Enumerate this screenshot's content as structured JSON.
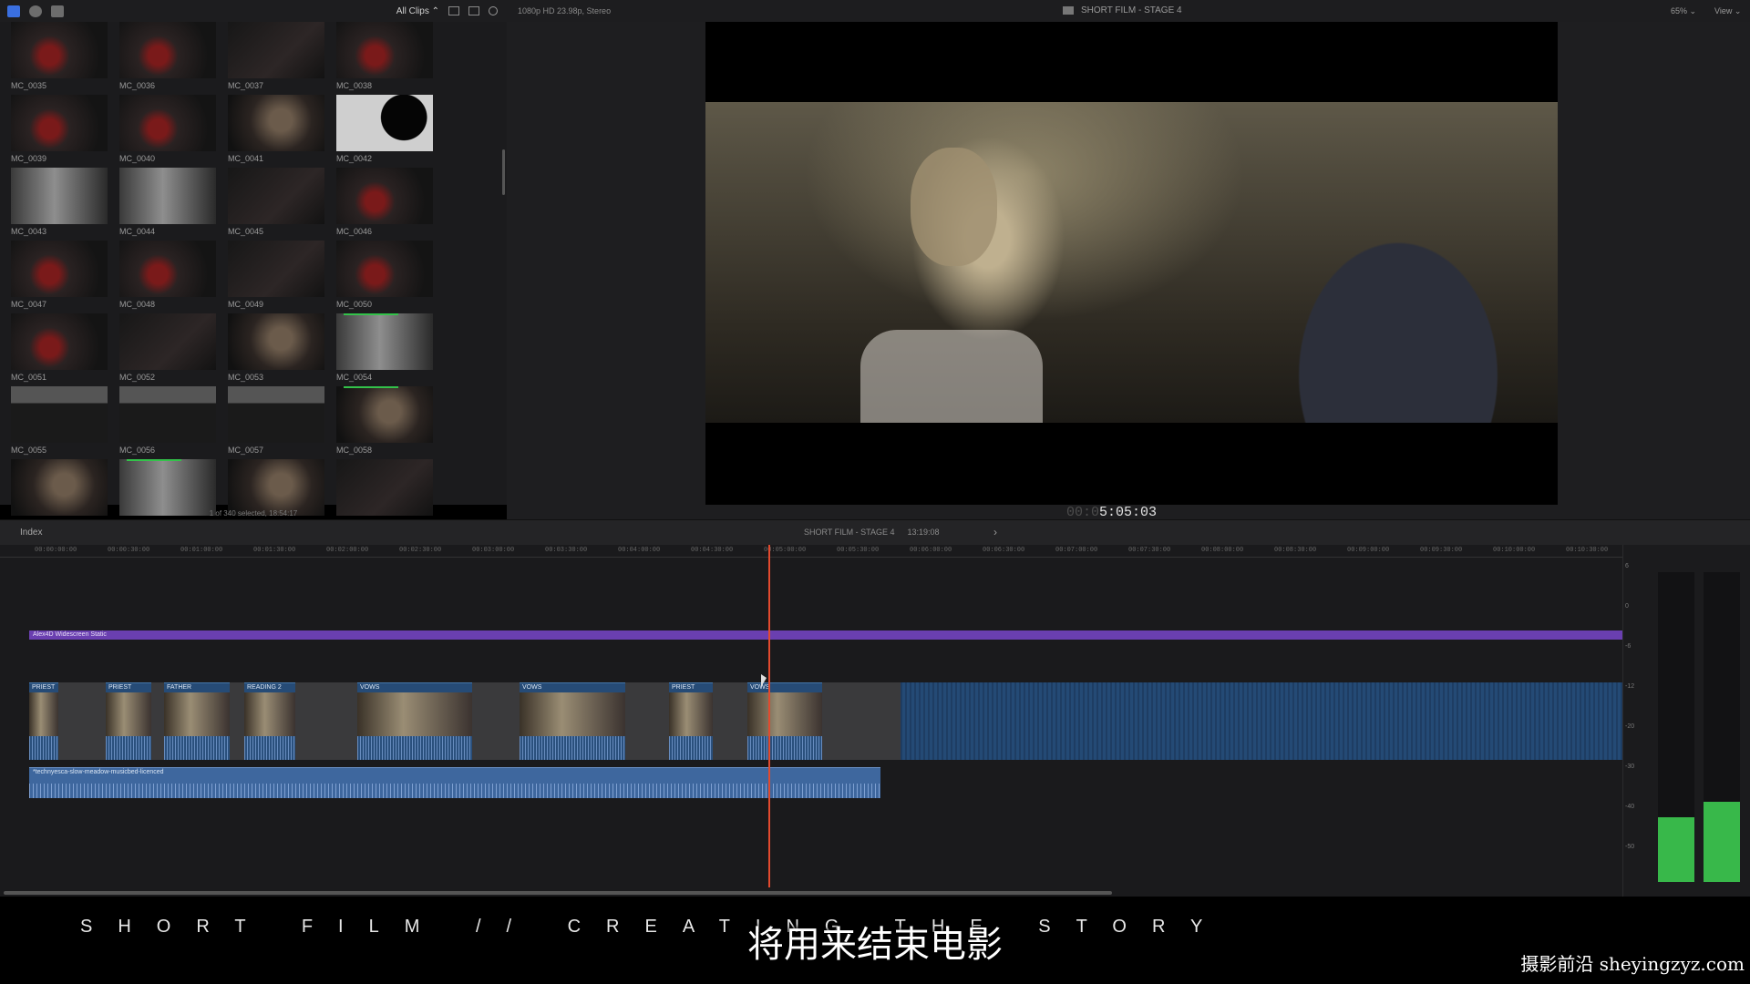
{
  "topbar": {
    "clips_filter": "All Clips ⌃",
    "format": "1080p HD 23.98p, Stereo",
    "project_title": "SHORT FILM - STAGE 4",
    "zoom": "65% ⌄",
    "view": "View ⌄"
  },
  "browser": {
    "clips": [
      {
        "name": "MC_0035",
        "style": "t-red"
      },
      {
        "name": "MC_0036",
        "style": "t-red"
      },
      {
        "name": "MC_0037",
        "style": "t-dark"
      },
      {
        "name": "MC_0038",
        "style": "t-red"
      },
      {
        "name": "MC_0039",
        "style": "t-red"
      },
      {
        "name": "MC_0040",
        "style": "t-red"
      },
      {
        "name": "MC_0041",
        "style": "t-warm"
      },
      {
        "name": "MC_0042",
        "style": "t-blk"
      },
      {
        "name": "MC_0043",
        "style": "t-light"
      },
      {
        "name": "MC_0044",
        "style": "t-light"
      },
      {
        "name": "MC_0045",
        "style": "t-dark"
      },
      {
        "name": "MC_0046",
        "style": "t-red"
      },
      {
        "name": "MC_0047",
        "style": "t-red"
      },
      {
        "name": "MC_0048",
        "style": "t-red"
      },
      {
        "name": "MC_0049",
        "style": "t-dark"
      },
      {
        "name": "MC_0050",
        "style": "t-red"
      },
      {
        "name": "MC_0051",
        "style": "t-red"
      },
      {
        "name": "MC_0052",
        "style": "t-dark"
      },
      {
        "name": "MC_0053",
        "style": "t-warm"
      },
      {
        "name": "MC_0054",
        "style": "t-light",
        "marked": true
      },
      {
        "name": "MC_0055",
        "style": "t-suit"
      },
      {
        "name": "MC_0056",
        "style": "t-suit"
      },
      {
        "name": "MC_0057",
        "style": "t-suit"
      },
      {
        "name": "MC_0058",
        "style": "t-warm",
        "marked": true
      },
      {
        "name": "",
        "style": "t-warm"
      },
      {
        "name": "",
        "style": "t-light",
        "marked": true
      },
      {
        "name": "",
        "style": "t-warm"
      },
      {
        "name": "",
        "style": "t-dark"
      }
    ],
    "status": "1 of 340 selected, 18:54:17"
  },
  "viewer": {
    "timecode_dim": "00:0",
    "timecode": "5:05:03"
  },
  "timeline": {
    "index_label": "Index",
    "project_name": "SHORT FILM - STAGE 4",
    "duration": "13:19:08",
    "ruler_ticks": [
      "00:00:00:00",
      "00:00:30:00",
      "00:01:00:00",
      "00:01:30:00",
      "00:02:00:00",
      "00:02:30:00",
      "00:03:00:00",
      "00:03:30:00",
      "00:04:00:00",
      "00:04:30:00",
      "00:05:00:00",
      "00:05:30:00",
      "00:06:00:00",
      "00:06:30:00",
      "00:07:00:00",
      "00:07:30:00",
      "00:08:00:00",
      "00:08:30:00",
      "00:09:00:00",
      "00:09:30:00",
      "00:10:00:00",
      "00:10:30:00"
    ],
    "title_bar": "Alex4D Widescreen Static",
    "clips": [
      {
        "label": "PRIEST"
      },
      {
        "label": "PRIEST"
      },
      {
        "label": "FATHER"
      },
      {
        "label": "READING 2"
      },
      {
        "label": "VOWS"
      },
      {
        "label": "VOWS"
      },
      {
        "label": "PRIEST"
      },
      {
        "label": "VOWS"
      }
    ],
    "music": "*technyesca-slow-meadow-musicbed-licenced"
  },
  "meters": {
    "scale": [
      "6",
      "0",
      "-6",
      "-12",
      "-20",
      "-30",
      "-40",
      "-50"
    ],
    "left_level": 0.21,
    "right_level": 0.26,
    "colors": {
      "meter": "#38b84a"
    }
  },
  "overlay": {
    "film_title": "SHORT FILM // CREATING THE STORY",
    "subtitle": "将用来结束电影",
    "watermark": "摄影前沿 sheyingzyz.com"
  },
  "colors": {
    "title_bar": "#6a3fb0",
    "clip_blue": "#264b76",
    "playhead": "#e24a2e"
  }
}
